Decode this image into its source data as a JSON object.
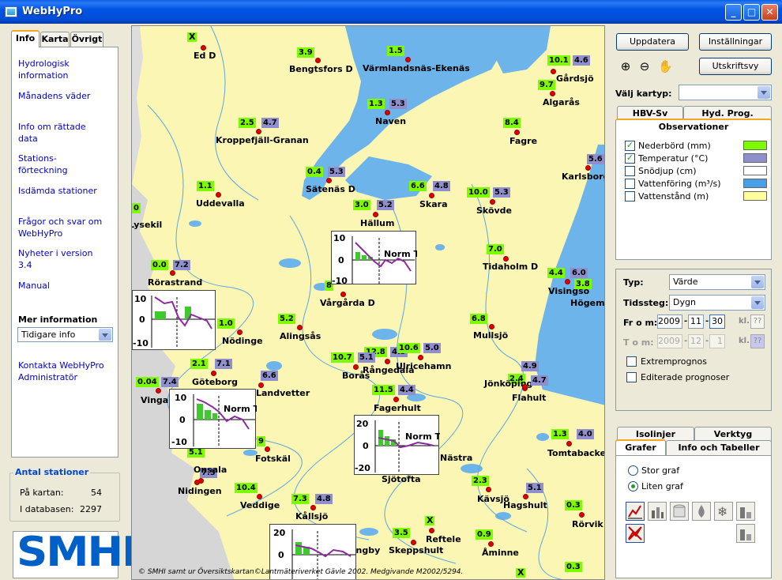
{
  "window": {
    "title": "WebHyPro"
  },
  "left": {
    "tabs": [
      "Info",
      "Karta",
      "Övrigt"
    ],
    "links": [
      "Hydrologisk\ninformation",
      "Månadens väder",
      "Info om rättade\ndata",
      "Stations-\nförteckning",
      "Isdämda stationer",
      "Frågor och svar om\nWebHyPro",
      "Nyheter i version\n3.4",
      "Manual",
      "Kontakta WebHyPro\nAdministratör"
    ],
    "mer_information": "Mer information",
    "mer_select": "Tidigare info",
    "antal": {
      "title": "Antal stationer",
      "pa_kartan_label": "På kartan:",
      "pa_kartan_value": "54",
      "i_databasen_label": "I databasen:",
      "i_databasen_value": "2297"
    },
    "logo": "SMHI"
  },
  "map": {
    "copyright": "© SMHI samt ur Översiktskartan©Lantmäteriverket Gävle 2002. Medgivande M2002/5294.",
    "stations": [
      {
        "name": "Ed D",
        "p": null,
        "t": null,
        "x": "X"
      },
      {
        "name": "Bengtsfors D",
        "p": "3.9",
        "t": null
      },
      {
        "name": "Värmlandsnäs-Ekenäs",
        "p": "1.5",
        "t": null
      },
      {
        "name": "Gårdsjö",
        "p": "10.1",
        "t": "4.6"
      },
      {
        "name": "Algarås",
        "p": "9.7",
        "t": null
      },
      {
        "name": "Naven",
        "p": "1.3",
        "t": "5.3"
      },
      {
        "name": "Kroppefjäll-Granan",
        "p": "2.5",
        "t": "4.7"
      },
      {
        "name": "Fagre",
        "p": "8.4",
        "t": null
      },
      {
        "name": "Sätenäs D",
        "p": "0.4",
        "t": "5.3"
      },
      {
        "name": "Karlsborg",
        "p": null,
        "t": "5.6"
      },
      {
        "name": "Uddevalla",
        "p": "1.1",
        "t": null
      },
      {
        "name": "Skara",
        "p": "6.6",
        "t": "4.8"
      },
      {
        "name": "Skövde",
        "p": "10.0",
        "t": "5.3"
      },
      {
        "name": "Hällum",
        "p": "3.0",
        "t": "5.2"
      },
      {
        "name": "Lysekil",
        "p": "0",
        "t": null
      },
      {
        "name": "Tidaholm D",
        "p": "7.0",
        "t": null
      },
      {
        "name": "Rörastrand",
        "p": "0.0",
        "t": "7.2"
      },
      {
        "name": "Visingsö",
        "p": "4.4",
        "t": "6.0"
      },
      {
        "name": "Högem",
        "p": "3.8",
        "t": null
      },
      {
        "name": "Vårgårda D",
        "p": "8",
        "t": null
      },
      {
        "name": "Nödinge",
        "p": "1.0",
        "t": null
      },
      {
        "name": "Alingsås",
        "p": "5.2",
        "t": null
      },
      {
        "name": "Mullsjö",
        "p": "6.8",
        "t": null
      },
      {
        "name": "Rångedala",
        "p": "12.8",
        "t": "4.3"
      },
      {
        "name": "Ulricehamn",
        "p": "10.6",
        "t": "5.0"
      },
      {
        "name": "Borås",
        "p": "10.7",
        "t": "5.1"
      },
      {
        "name": "Göteborg",
        "p": "2.1",
        "t": "7.1"
      },
      {
        "name": "Landvetter",
        "p": null,
        "t": "6.6"
      },
      {
        "name": "Vinga",
        "p": "0.04",
        "t": "7.4"
      },
      {
        "name": "Jönköping",
        "p": "2.4",
        "t": "4.9"
      },
      {
        "name": "Flahult",
        "p": null,
        "t": "4.7"
      },
      {
        "name": "Fagerhult",
        "p": "11.5",
        "t": "4.4"
      },
      {
        "name": "Fotskäl",
        "p": "9",
        "t": null
      },
      {
        "name": "Onsala",
        "p": "5.1",
        "t": "7.3"
      },
      {
        "name": "Tomtabacken",
        "p": "1.3",
        "t": "4.0"
      },
      {
        "name": "Nidingen",
        "p": null,
        "t": null
      },
      {
        "name": "Sjötofta",
        "p": null,
        "t": null
      },
      {
        "name": "Nästra",
        "p": null,
        "t": null
      },
      {
        "name": "Veddige",
        "p": "10.4",
        "t": null
      },
      {
        "name": "Kållsjö",
        "p": "7.3",
        "t": "4.8"
      },
      {
        "name": "Kävsjö",
        "p": "2.3",
        "t": null
      },
      {
        "name": "Hagshult",
        "p": null,
        "t": "5.1"
      },
      {
        "name": "Rörvik",
        "p": "0.3",
        "t": null
      },
      {
        "name": "Skeppshult",
        "p": "3.5",
        "t": null
      },
      {
        "name": "Reftele",
        "p": null,
        "t": null,
        "x": "X"
      },
      {
        "name": "Åminne",
        "p": "0.9",
        "t": null
      },
      {
        "name": "Ängby",
        "p": null,
        "t": null
      }
    ],
    "minigraph_label": "Norm T",
    "minigraphs": [
      {
        "ymax": "10",
        "ymid": "0",
        "ymin": "-10"
      },
      {
        "ymax": "10",
        "ymid": "0",
        "ymin": "-10"
      },
      {
        "ymax": "10",
        "ymid": "0",
        "ymin": "-10"
      },
      {
        "ymax": "20",
        "ymid": "0",
        "ymin": "-20"
      },
      {
        "ymax": "20",
        "ymid": "0",
        "ymin": ""
      }
    ],
    "x_extra": "X"
  },
  "right": {
    "buttons": {
      "uppdatera": "Uppdatera",
      "installningar": "Inställningar",
      "utskriftsvy": "Utskriftsvy"
    },
    "valj_kartyp": "Välj kartyp:",
    "tabs_top": [
      "HBV-Sv",
      "Hyd. Prog.",
      "Observationer"
    ],
    "observations": [
      {
        "label": "Nederbörd (mm)",
        "checked": true,
        "color": "#7cfc00"
      },
      {
        "label": "Temperatur (°C)",
        "checked": true,
        "color": "#8f8fce"
      },
      {
        "label": "Snödjup (cm)",
        "checked": false,
        "color": "#ffffff"
      },
      {
        "label": "Vattenföring (m³/s)",
        "checked": false,
        "color": "#4aa0e8"
      },
      {
        "label": "Vattenstånd (m)",
        "checked": false,
        "color": "#fffe9a"
      }
    ],
    "typ_label": "Typ:",
    "typ_value": "Värde",
    "tidssteg_label": "Tidssteg:",
    "tidssteg_value": "Dygn",
    "from_label": "Fr o m:",
    "from": {
      "year": "2009",
      "month": "11",
      "day": "30",
      "kl": "kl.",
      "q": "??"
    },
    "tom_label": "T o m:",
    "tom": {
      "year": "2009",
      "month": "12",
      "day": "1",
      "kl": "kl.",
      "q": "??"
    },
    "extremprognos": "Extremprognos",
    "editerade": "Editerade prognoser",
    "tabs_bottom_row1": [
      "Isolinjer",
      "Verktyg"
    ],
    "tabs_bottom_row2": [
      "Grafer",
      "Info och Tabeller"
    ],
    "stor_graf": "Stor graf",
    "liten_graf": "Liten graf"
  }
}
